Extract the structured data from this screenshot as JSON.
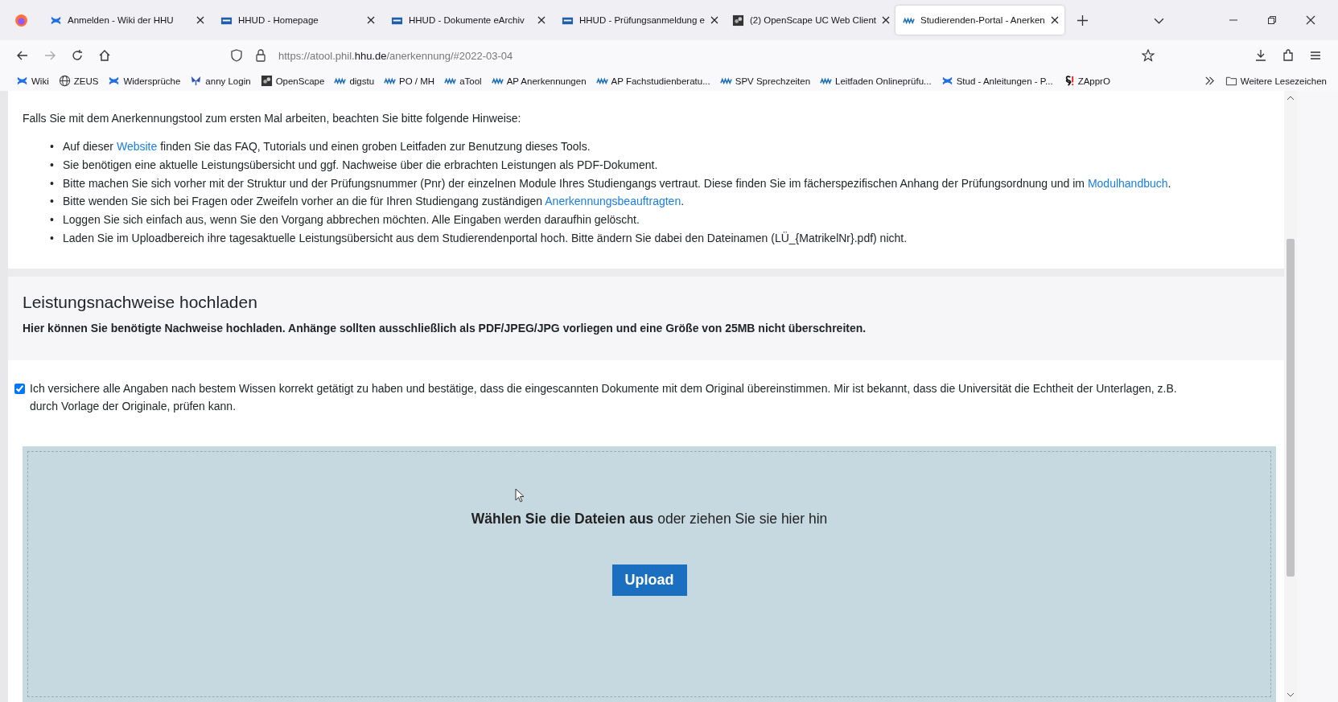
{
  "tabs": [
    {
      "title": "Anmelden - Wiki der HHU",
      "kind": "confluence",
      "selected": false
    },
    {
      "title": "HHUD - Homepage",
      "kind": "hhud",
      "selected": false
    },
    {
      "title": "HHUD - Dokumente eArchiv",
      "kind": "hhud",
      "selected": false
    },
    {
      "title": "HHUD - Prüfungsanmeldung e",
      "kind": "hhud",
      "selected": false
    },
    {
      "title": "(2) OpenScape UC Web Client",
      "kind": "openscape",
      "selected": false
    },
    {
      "title": "Studierenden-Portal - Anerken",
      "kind": "hhu",
      "selected": true
    }
  ],
  "address_bar": {
    "prefix": "https://atool.phil.",
    "domain": "hhu.de",
    "path": "/anerkennung/#2022-03-04"
  },
  "bookmarks": [
    {
      "label": "Wiki",
      "kind": "confluence"
    },
    {
      "label": "ZEUS",
      "kind": "globe"
    },
    {
      "label": "Widersprüche",
      "kind": "confluence"
    },
    {
      "label": "anny Login",
      "kind": "anny"
    },
    {
      "label": "OpenScape",
      "kind": "openscape"
    },
    {
      "label": "digstu",
      "kind": "hhu"
    },
    {
      "label": "PO / MH",
      "kind": "hhu"
    },
    {
      "label": "aTool",
      "kind": "hhu"
    },
    {
      "label": "AP Anerkennungen",
      "kind": "hhu"
    },
    {
      "label": "AP Fachstudienberatu...",
      "kind": "hhu"
    },
    {
      "label": "SPV Sprechzeiten",
      "kind": "hhu"
    },
    {
      "label": "Leitfaden Onlineprüfu...",
      "kind": "hhu"
    },
    {
      "label": "Stud - Anleitungen - P...",
      "kind": "confluence"
    },
    {
      "label": "ZApprO",
      "kind": "paragraph"
    }
  ],
  "other_bookmarks": "Weitere Lesezeichen",
  "intro": "Falls Sie mit dem Anerkennungstool zum ersten Mal arbeiten, beachten Sie bitte folgende Hinweise:",
  "hints": [
    {
      "marker": "•",
      "parts": [
        {
          "text": "Auf dieser ",
          "kind": "text"
        },
        {
          "text": "Website",
          "kind": "link"
        },
        {
          "text": " finden Sie das FAQ, Tutorials und einen groben Leitfaden zur Benutzung dieses Tools.",
          "kind": "text"
        }
      ]
    },
    {
      "marker": "•",
      "parts": [
        {
          "text": "Sie benötigen eine aktuelle Leistungsübersicht und ggf. Nachweise über die erbrachten Leistungen als PDF-Dokument.",
          "kind": "text"
        }
      ]
    },
    {
      "marker": "•",
      "parts": [
        {
          "text": "Bitte machen Sie sich vorher mit der Struktur und der Prüfungsnummer (Pnr) der einzelnen Module Ihres Studiengangs vertraut. Diese finden Sie im fächerspezifischen Anhang der Prüfungsordnung und im ",
          "kind": "text"
        },
        {
          "text": "Modulhandbuch",
          "kind": "link"
        },
        {
          "text": ".",
          "kind": "text"
        }
      ]
    },
    {
      "marker": "•",
      "parts": [
        {
          "text": "Bitte wenden Sie sich bei Fragen oder Zweifeln vorher an die für Ihren Studiengang zuständigen ",
          "kind": "text"
        },
        {
          "text": "Anerkennungsbeauftragten",
          "kind": "link"
        },
        {
          "text": ".",
          "kind": "text"
        }
      ]
    },
    {
      "marker": "•",
      "parts": [
        {
          "text": "Loggen Sie sich einfach aus, wenn Sie den Vorgang abbrechen möchten. Alle Eingaben werden daraufhin gelöscht.",
          "kind": "text"
        }
      ]
    },
    {
      "marker": "•",
      "parts": [
        {
          "text": "Laden Sie im Uploadbereich ihre tagesaktuelle Leistungsübersicht aus dem Studierendenportal hoch. Bitte ändern Sie dabei den Dateinamen (LÜ_{MatrikelNr}.pdf) nicht.",
          "kind": "text"
        }
      ]
    }
  ],
  "upload_section": {
    "title": "Leistungsnachweise hochladen",
    "description": "Hier können Sie benötigte Nachweise hochladen. Anhänge sollten ausschließlich als PDF/JPEG/JPG vorliegen und eine Größe von 25MB nicht überschreiten."
  },
  "confirmation": {
    "checked": true,
    "text": "Ich versichere alle Angaben nach bestem Wissen korrekt getätigt zu haben und bestätige, dass die eingescannten Dokumente mit dem Original übereinstimmen. Mir ist bekannt, dass die Universität die Echtheit der Unterlagen, z.B. durch Vorlage der Originale, prüfen kann."
  },
  "dropzone": {
    "prompt": "**Wählen Sie die Dateien aus** oder ziehen Sie sie hier hin",
    "button": "Upload"
  }
}
